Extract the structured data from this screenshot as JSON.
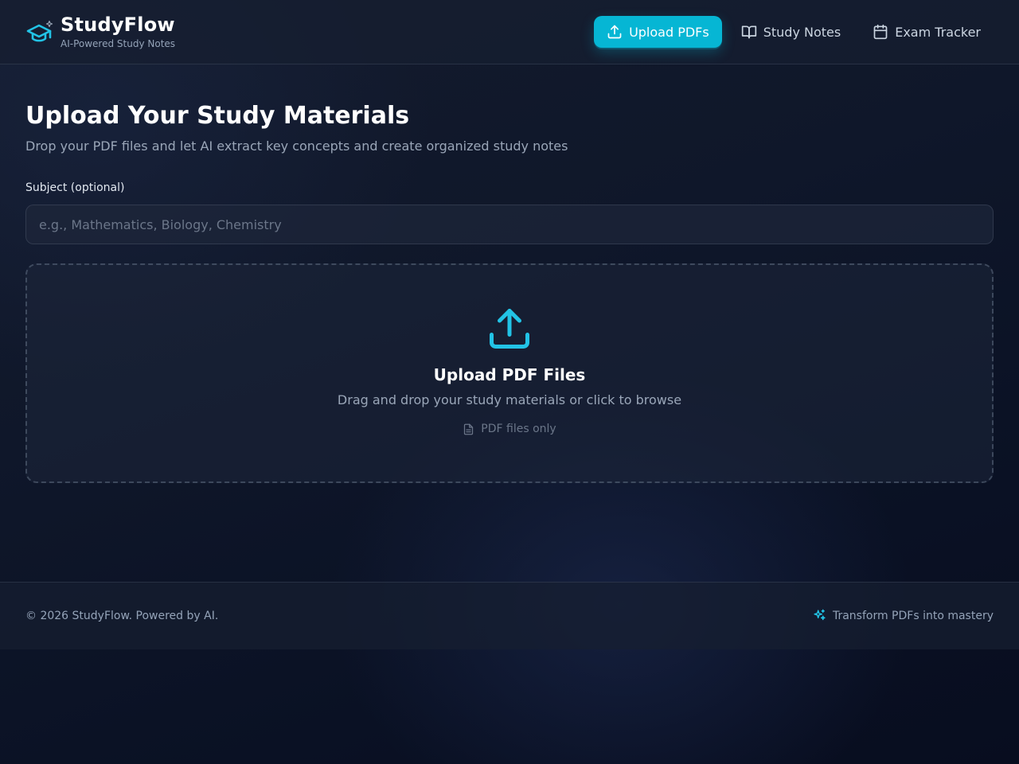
{
  "brand": {
    "title": "StudyFlow",
    "subtitle": "AI-Powered Study Notes",
    "icon": "graduation-cap-icon",
    "accent_color": "#06b6d4"
  },
  "nav": {
    "items": [
      {
        "label": "Upload PDFs",
        "icon": "upload-icon",
        "active": true
      },
      {
        "label": "Study Notes",
        "icon": "book-open-icon",
        "active": false
      },
      {
        "label": "Exam Tracker",
        "icon": "calendar-icon",
        "active": false
      }
    ]
  },
  "main": {
    "title": "Upload Your Study Materials",
    "description": "Drop your PDF files and let AI extract key concepts and create organized study notes",
    "subject_label": "Subject (optional)",
    "subject_placeholder": "e.g., Mathematics, Biology, Chemistry",
    "subject_value": "",
    "dropzone": {
      "icon": "upload-icon",
      "title": "Upload PDF Files",
      "subtitle": "Drag and drop your study materials or click to browse",
      "note_icon": "file-text-icon",
      "note": "PDF files only"
    }
  },
  "footer": {
    "copyright": "© 2026 StudyFlow. Powered by AI.",
    "tagline_icon": "sparkles-icon",
    "tagline": "Transform PDFs into mastery"
  }
}
